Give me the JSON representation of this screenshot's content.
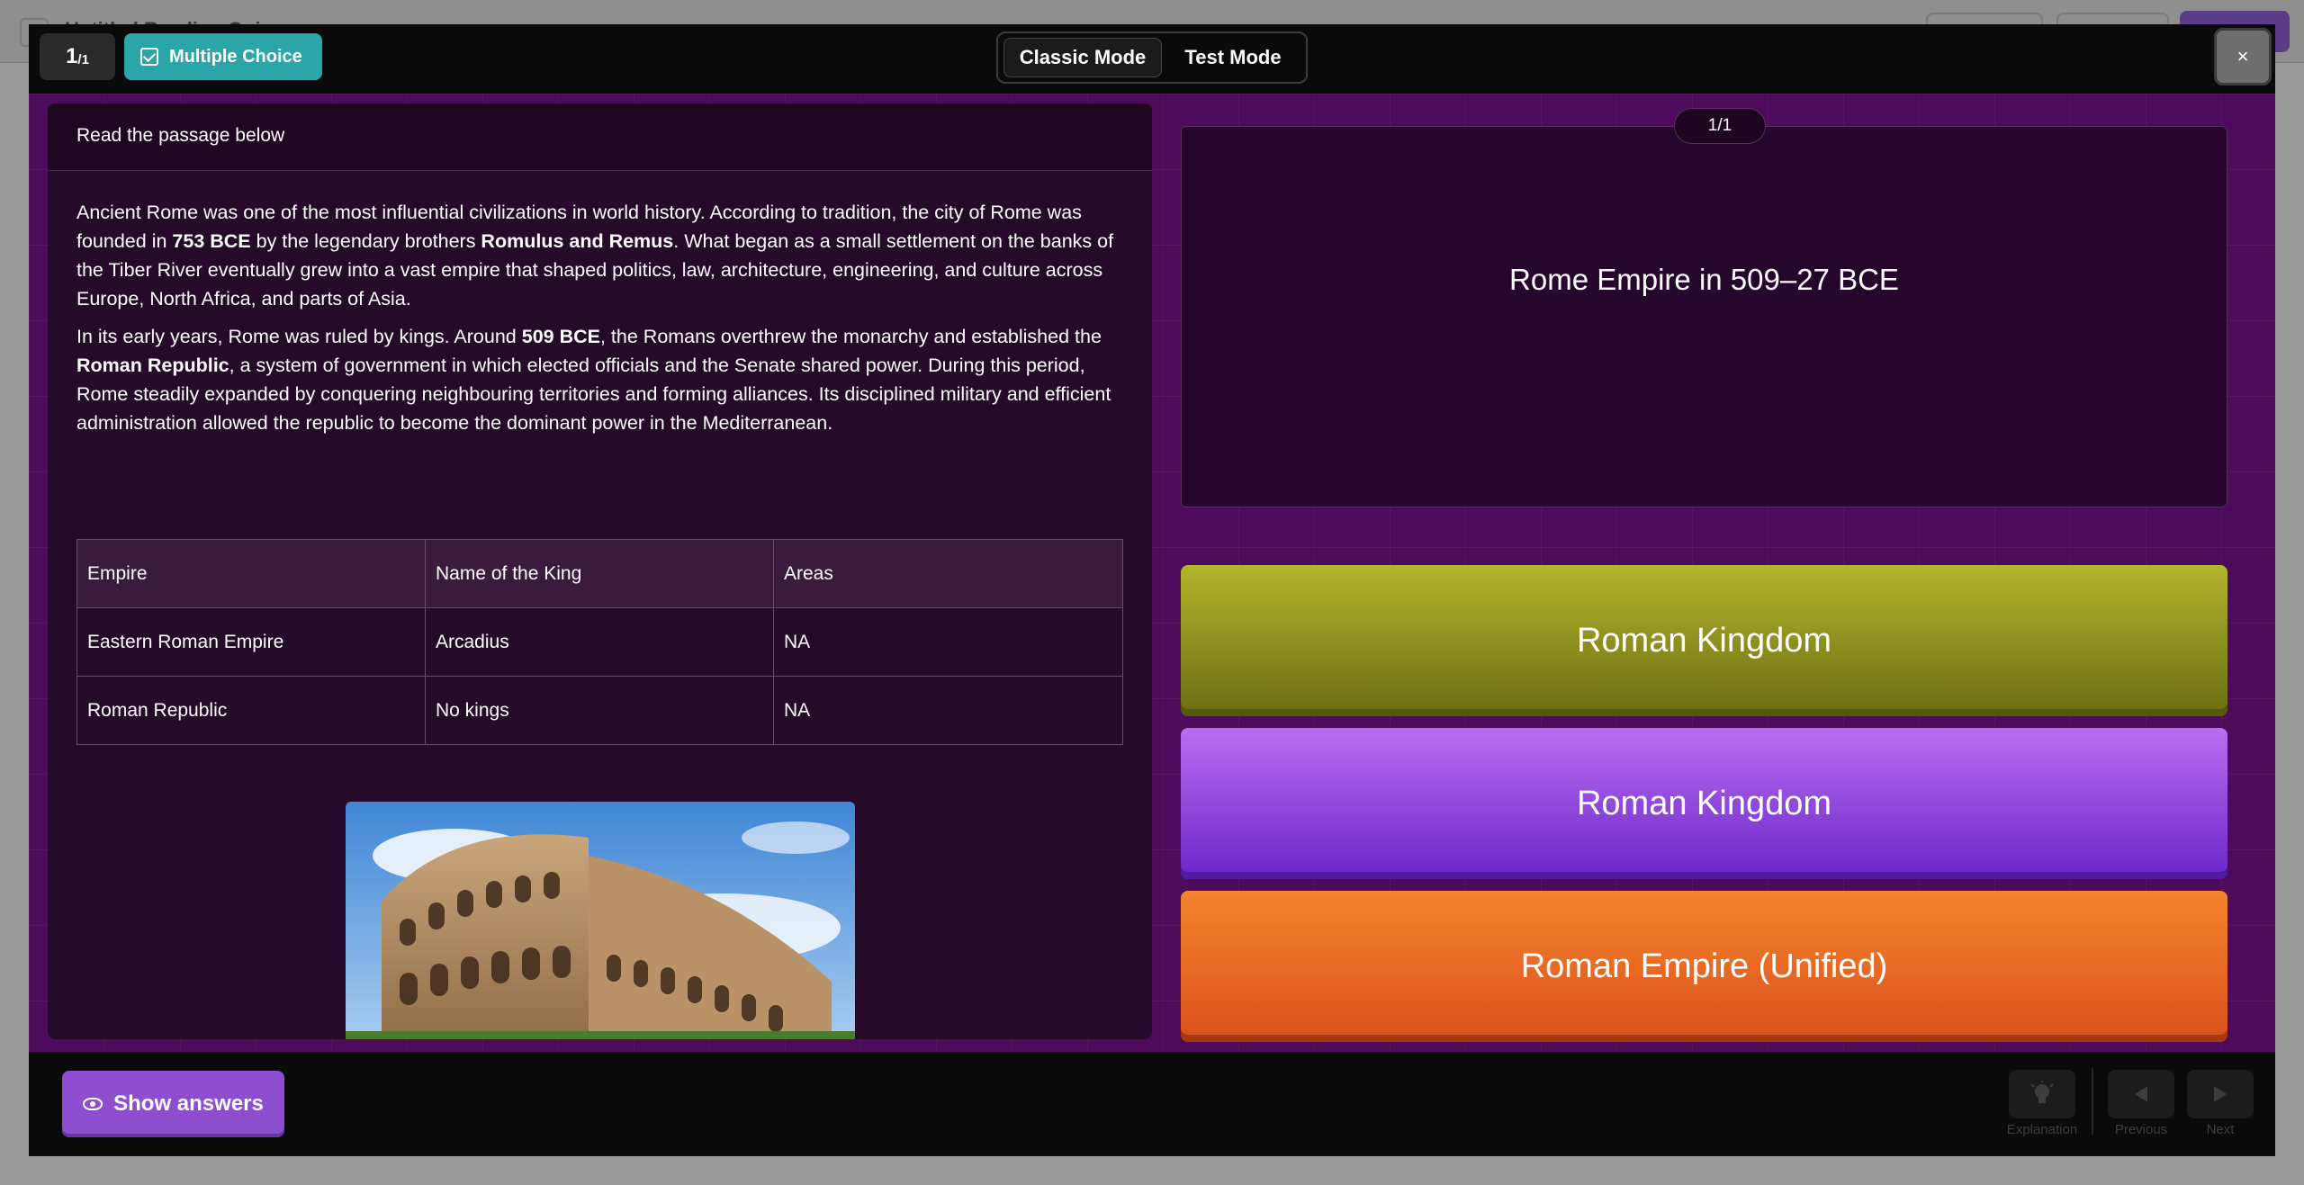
{
  "background": {
    "title": "Untitled Reading Quiz"
  },
  "header": {
    "count_main": "1",
    "count_sub": "/1",
    "type_label": "Multiple Choice",
    "modes": [
      "Classic Mode",
      "Test Mode"
    ],
    "active_mode": "Classic Mode",
    "close_label": "×"
  },
  "passage": {
    "heading": "Read the passage below",
    "p1": {
      "t1": "Ancient Rome was one of the most influential civilizations in world history. According to tradition, the city of Rome was founded in ",
      "b1": "753 BCE",
      "t2": " by the legendary brothers ",
      "b2": "Romulus and Remus",
      "t3": ". What began as a small settlement on the banks of the Tiber River eventually grew into a vast empire that shaped politics, law, architecture, engineering, and culture across Europe, North Africa, and parts of Asia."
    },
    "p2": {
      "t1": "In its early years, Rome was ruled by kings. Around ",
      "b1": "509 BCE",
      "t2": ", the Romans overthrew the monarchy and established the ",
      "b2": "Roman Republic",
      "t3": ", a system of government in which elected officials and the Senate shared power. During this period, Rome steadily expanded by conquering neighbouring territories and forming alliances. Its disciplined military and efficient administration allowed the republic to become the dominant power in the Mediterranean."
    },
    "table": {
      "headers": [
        "Empire",
        "Name of the King",
        "Areas"
      ],
      "rows": [
        [
          "Eastern Roman Empire",
          "Arcadius",
          "NA"
        ],
        [
          "Roman Republic",
          "No kings",
          "NA"
        ]
      ]
    }
  },
  "question": {
    "counter": "1/1",
    "text": "Rome Empire in 509–27 BCE",
    "answers": [
      "Roman Kingdom",
      "Roman Kingdom",
      "Roman Empire (Unified)"
    ]
  },
  "footer": {
    "show_answers": "Show answers",
    "explanation": "Explanation",
    "previous": "Previous",
    "next": "Next"
  },
  "colors": {
    "accent_purple": "#8d4fd0",
    "teal": "#2aa6a9",
    "answer_olive": "#9a9c22",
    "answer_violet": "#8d45e0",
    "answer_orange": "#ef6b25"
  }
}
